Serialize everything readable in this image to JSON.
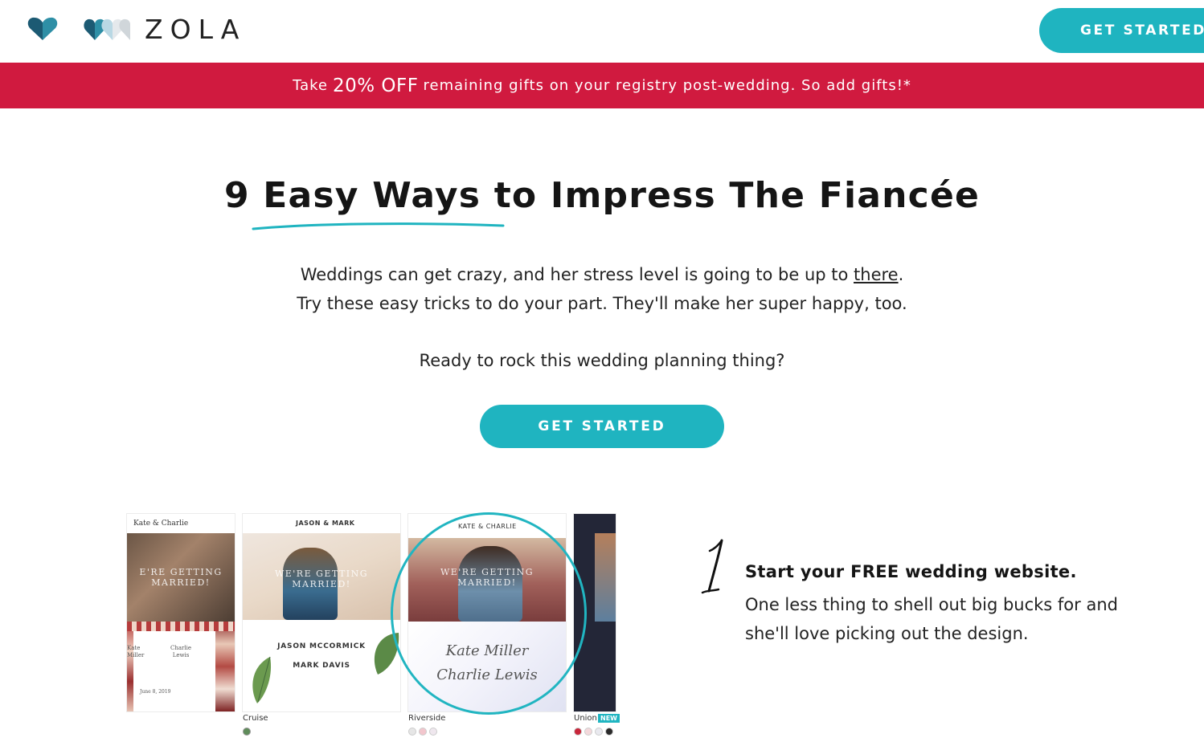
{
  "header": {
    "brand_name": "ZOLA",
    "cta_label": "GET STARTED"
  },
  "promo": {
    "prefix": "Take",
    "highlight": "20% OFF",
    "suffix": "remaining gifts on your registry post-wedding. So add gifts!*"
  },
  "hero": {
    "title": "9 Easy Ways to Impress The Fiancée",
    "line1_before": "Weddings can get crazy, and her stress level is going to be up to ",
    "line1_link": "there",
    "line1_after": ".",
    "line2": "Try these easy tricks to do your part. They'll make her super happy, too.",
    "line3": "Ready to rock this wedding planning thing?",
    "cta_label": "GET STARTED"
  },
  "templates": {
    "cards": [
      {
        "header": "Kate & Charlie",
        "overlay": [
          "E'RE GETTING",
          "MARRIED!"
        ],
        "name_left": [
          "Kate",
          "Miller"
        ],
        "name_right": [
          "Charlie",
          "Lewis"
        ],
        "date": "June 8, 2019"
      },
      {
        "header": "JASON & MARK",
        "overlay": [
          "WE'RE GETTING",
          "MARRIED!"
        ],
        "name1": "JASON MCCORMICK",
        "name2": "MARK DAVIS",
        "caption": "Cruise"
      },
      {
        "header": "KATE & CHARLIE",
        "overlay": [
          "WE'RE GETTING",
          "MARRIED!"
        ],
        "script1": "Kate Miller",
        "script2": "Charlie Lewis",
        "caption": "Riverside"
      },
      {
        "caption": "Union",
        "badge": "NEW"
      }
    ],
    "colors": {
      "accent": "#1fb4c0",
      "promo": "#d01a3f"
    }
  },
  "step1": {
    "numeral": "1",
    "title": "Start your FREE wedding website.",
    "body": "One less thing to shell out big bucks for and she'll love picking out the design."
  }
}
